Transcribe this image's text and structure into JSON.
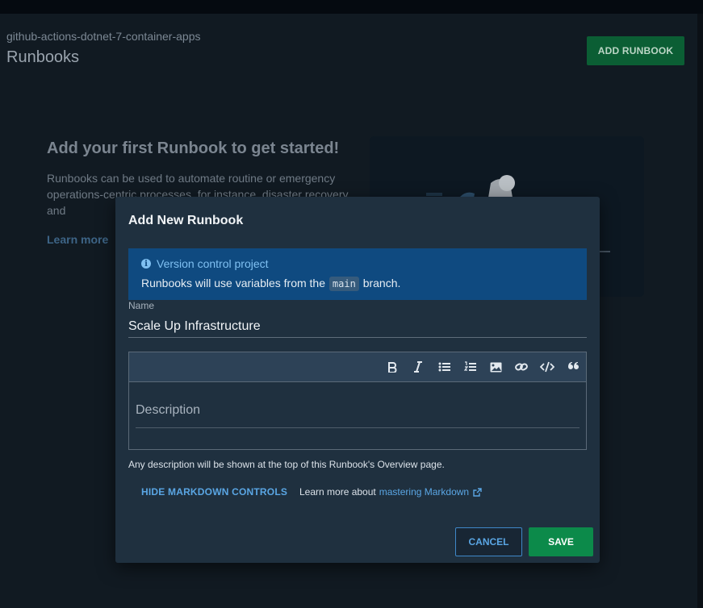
{
  "project": {
    "name": "github-actions-dotnet-7-container-apps",
    "page_title": "Runbooks",
    "add_button_label": "ADD RUNBOOK"
  },
  "empty_state": {
    "heading": "Add your first Runbook to get started!",
    "paragraph": "Runbooks can be used to automate routine or emergency operations-centric processes, for instance, disaster recovery and",
    "learn_more": "Learn more"
  },
  "dialog": {
    "title": "Add New Runbook",
    "alert": {
      "heading": "Version control project",
      "text_before": "Runbooks will use variables from the",
      "branch": "main",
      "text_after": "branch."
    },
    "name_field": {
      "label": "Name",
      "value": "Scale Up Infrastructure"
    },
    "description_field": {
      "placeholder": "Description",
      "value": ""
    },
    "toolbar": [
      {
        "icon": "bold-icon"
      },
      {
        "icon": "italic-icon"
      },
      {
        "icon": "bulleted-list-icon"
      },
      {
        "icon": "numbered-list-icon"
      },
      {
        "icon": "image-icon"
      },
      {
        "icon": "link-icon"
      },
      {
        "icon": "code-icon"
      },
      {
        "icon": "quote-icon"
      }
    ],
    "helper_text": "Any description will be shown at the top of this Runbook's Overview page.",
    "hide_markdown_label": "HIDE MARKDOWN CONTROLS",
    "learn_more_prefix": "Learn more about",
    "learn_more_link": "mastering Markdown",
    "cancel_label": "CANCEL",
    "save_label": "SAVE"
  },
  "colors": {
    "primary_green": "#0c8a4a",
    "link_blue": "#5aa6e4",
    "alert_bg": "#0f4a80",
    "dialog_bg": "#1f303f"
  }
}
